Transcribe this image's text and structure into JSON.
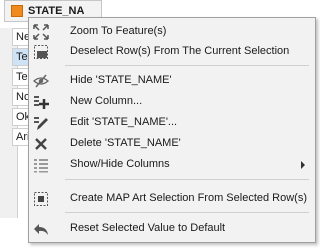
{
  "column_header": {
    "label": "STATE_NA"
  },
  "table_rows": [
    "New",
    "Tex",
    "Ten",
    "Nor",
    "Okl",
    "Ariz"
  ],
  "menu": {
    "zoom_to_feature": "Zoom To Feature(s)",
    "deselect_rows": "Deselect Row(s) From The Current Selection",
    "hide_column": "Hide 'STATE_NAME'",
    "new_column": "New Column...",
    "edit_column": "Edit 'STATE_NAME'...",
    "delete_column": "Delete 'STATE_NAME'",
    "show_hide_columns": "Show/Hide Columns",
    "create_map_art_selection": "Create MAP Art Selection From Selected Row(s)",
    "reset_value": "Reset Selected Value to Default"
  },
  "colors": {
    "menu_background": "#f2f2f2",
    "selected_row": "#cfe3f7",
    "header_icon": "#f08a1c"
  }
}
